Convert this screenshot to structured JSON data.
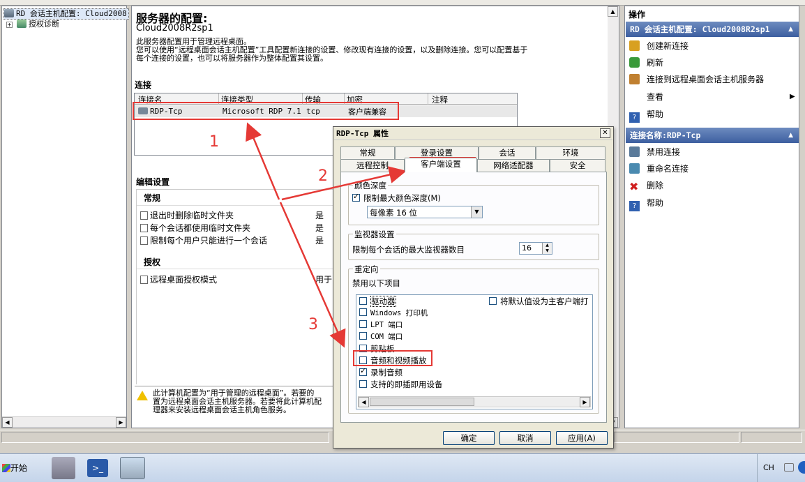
{
  "tree": {
    "root_label": "RD 会话主机配置: Cloud2008",
    "child_label": "授权诊断"
  },
  "main": {
    "heading": "服务器的配置:",
    "server_name": "Cloud2008R2sp1",
    "desc_line1": "此服务器配置用于管理远程桌面。",
    "desc_line2": "您可以使用“远程桌面会话主机配置”工具配置新连接的设置、修改现有连接的设置，以及删除连接。您可以配置基于",
    "desc_line3": "每个连接的设置，也可以将服务器作为整体配置其设置。",
    "connections_title": "连接",
    "columns": [
      "连接名",
      "连接类型",
      "传输",
      "加密",
      "注释"
    ],
    "row": {
      "name": "RDP-Tcp",
      "type": "Microsoft RDP 7.1",
      "transport": "tcp",
      "encryption": "客户端兼容"
    },
    "edit_title": "编辑设置",
    "general_title": "常规",
    "general_items": [
      {
        "label": "退出时删除临时文件夹",
        "value": "是"
      },
      {
        "label": "每个会话都使用临时文件夹",
        "value": "是"
      },
      {
        "label": "限制每个用户只能进行一个会话",
        "value": "是"
      }
    ],
    "license_title": "授权",
    "license_item": {
      "label": "远程桌面授权模式",
      "value": "用于"
    },
    "warning_line1": "此计算机配置为“用于管理的远程桌面”。若要的",
    "warning_line2": "置为远程桌面会话主机服务器。若要将此计算机配",
    "warning_line3": "理器来安装远程桌面会话主机角色服务。"
  },
  "actions": {
    "title": "操作",
    "section1_title": "RD 会话主机配置: Cloud2008R2sp1",
    "section1_items": [
      "创建新连接",
      "刷新",
      "连接到远程桌面会话主机服务器",
      "查看",
      "帮助"
    ],
    "section2_title": "连接名称:RDP-Tcp",
    "section2_items": [
      "禁用连接",
      "重命名连接",
      "删除",
      "帮助"
    ]
  },
  "dialog": {
    "title": "RDP-Tcp 属性",
    "tabs_row1": [
      "常规",
      "登录设置",
      "会话",
      "环境"
    ],
    "tabs_row2": [
      "远程控制",
      "客户端设置",
      "网络适配器",
      "安全"
    ],
    "color_group": "颜色深度",
    "limit_color": "限制最大颜色深度(M)",
    "color_value": "每像素 16 位",
    "monitor_group": "监视器设置",
    "monitor_label": "限制每个会话的最大监视器数目",
    "monitor_value": "16",
    "redirect_group": "重定向",
    "disable_label": "禁用以下项目",
    "redirect_items": [
      "驱动器",
      "Windows 打印机",
      "LPT 端口",
      "COM 端口",
      "剪贴板",
      "音频和视频播放",
      "录制音频",
      "支持的即插即用设备"
    ],
    "default_printer": "将默认值设为主客户端打",
    "ok": "确定",
    "cancel": "取消",
    "apply": "应用(A)"
  },
  "annotations": [
    "1",
    "2",
    "3"
  ],
  "taskbar": {
    "start": "开始",
    "lang": "CH"
  },
  "colors": {
    "accent": "#3d5fa0",
    "annotation": "#e53935"
  }
}
